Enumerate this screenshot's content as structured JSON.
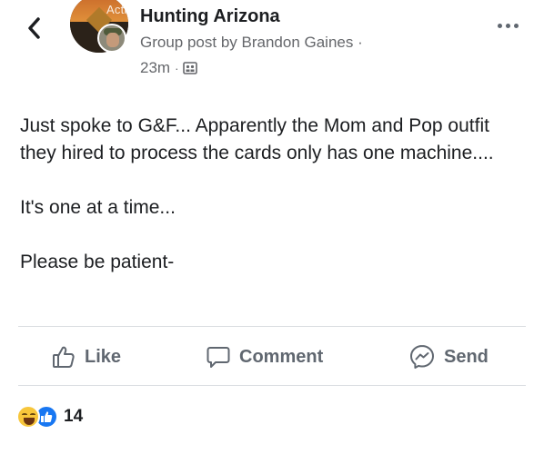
{
  "overlay": {
    "active_label": "Active Now"
  },
  "post": {
    "group_name": "Hunting Arizona",
    "author_line": "Group post by Brandon Gaines ·",
    "time": "23m",
    "paragraphs": [
      "Just spoke to G&F... Apparently the Mom and Pop outfit they hired to process the cards only has one machine....",
      "It's one at a time...",
      "Please be patient-"
    ]
  },
  "actions": {
    "like_label": "Like",
    "comment_label": "Comment",
    "send_label": "Send"
  },
  "reactions": {
    "count": "14",
    "types": [
      "haha",
      "like"
    ]
  },
  "icons": {
    "back": "chevron-left-icon",
    "more": "more-horizontal-icon",
    "audience": "group-audience-icon",
    "like": "thumbs-up-icon",
    "comment": "speech-bubble-icon",
    "send": "messenger-icon"
  },
  "colors": {
    "text": "#1c1e21",
    "secondary": "#65676b",
    "action": "#606770",
    "like_blue": "#1877f2",
    "haha_yellow": "#f7c63b"
  }
}
